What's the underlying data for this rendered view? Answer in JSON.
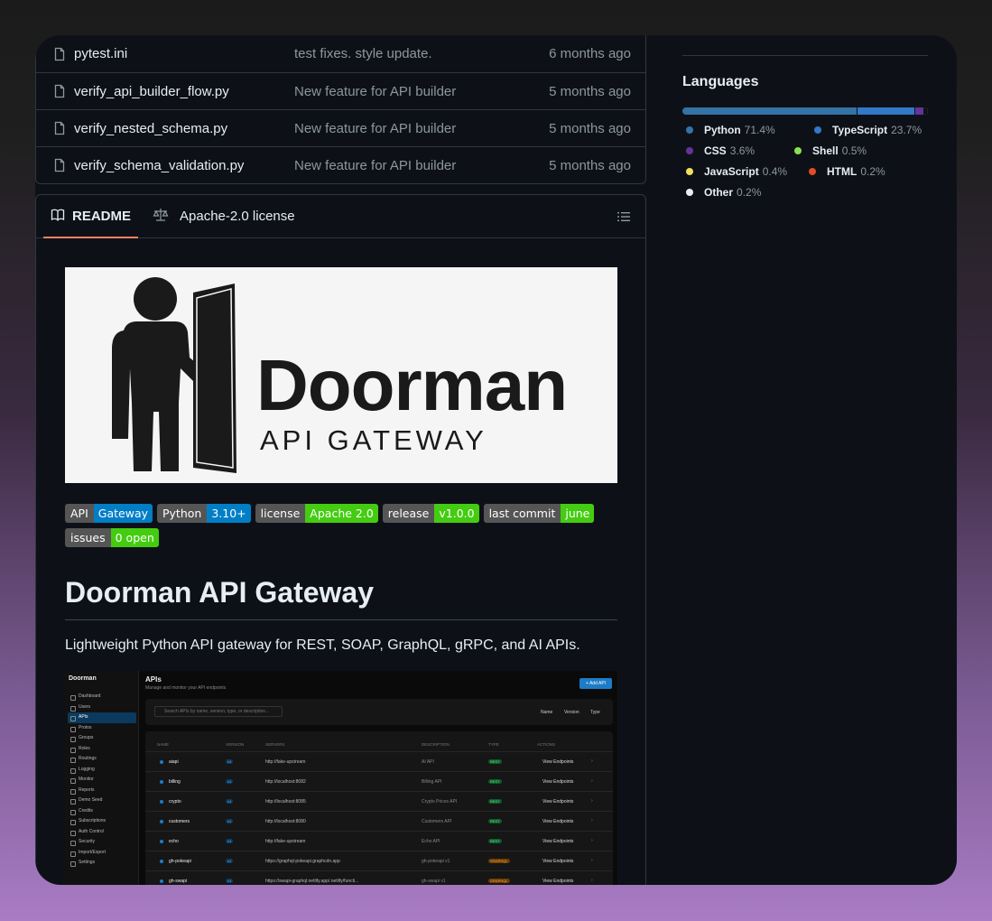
{
  "files": [
    {
      "name": "pytest.ini",
      "message": "test fixes. style update.",
      "time": "6 months ago"
    },
    {
      "name": "verify_api_builder_flow.py",
      "message": "New feature for API builder",
      "time": "5 months ago"
    },
    {
      "name": "verify_nested_schema.py",
      "message": "New feature for API builder",
      "time": "5 months ago"
    },
    {
      "name": "verify_schema_validation.py",
      "message": "New feature for API builder",
      "time": "5 months ago"
    }
  ],
  "readme": {
    "tabs": {
      "readme": "README",
      "license": "Apache-2.0 license"
    },
    "logo": {
      "title": "Doorman",
      "subtitle": "API GATEWAY"
    },
    "badges": [
      {
        "label": "API",
        "value": "Gateway",
        "color": "#007ec6"
      },
      {
        "label": "Python",
        "value": "3.10+",
        "color": "#007ec6"
      },
      {
        "label": "license",
        "value": "Apache 2.0",
        "color": "#4c1"
      },
      {
        "label": "release",
        "value": "v1.0.0",
        "color": "#4c1"
      },
      {
        "label": "last commit",
        "value": "june",
        "color": "#4c1"
      },
      {
        "label": "issues",
        "value": "0 open",
        "color": "#4c1"
      }
    ],
    "heading": "Doorman API Gateway",
    "description": "Lightweight Python API gateway for REST, SOAP, GraphQL, gRPC, and AI APIs.",
    "screenshot": {
      "brand": "Doorman",
      "nav": [
        "Dashboard",
        "Users",
        "APIs",
        "Protos",
        "Groups",
        "Roles",
        "Routings",
        "Logging",
        "Monitor",
        "Reports",
        "Demo Seed",
        "Credits",
        "Subscriptions",
        "Auth Control",
        "Security",
        "Import/Export",
        "Settings"
      ],
      "nav_active": "APIs",
      "title": "APIs",
      "subtitle": "Manage and monitor your API endpoints",
      "add_button": "+ Add API",
      "search_placeholder": "Search APIs by name, version, type, or description...",
      "filters": [
        "Name",
        "Version",
        "Type"
      ],
      "columns": [
        "NAME",
        "VERSION",
        "SERVERS",
        "DESCRIPTION",
        "TYPE",
        "ACTIONS"
      ],
      "rows": [
        {
          "name": "aiapi",
          "version": "v1",
          "server": "http://fake-upstream",
          "description": "AI API",
          "type": "REST",
          "action": "View Endpoints"
        },
        {
          "name": "billing",
          "version": "v1",
          "server": "http://localhost:8082",
          "description": "Billing API",
          "type": "REST",
          "action": "View Endpoints"
        },
        {
          "name": "crypto",
          "version": "v1",
          "server": "http://localhost:8085",
          "description": "Crypto Prices API",
          "type": "REST",
          "action": "View Endpoints"
        },
        {
          "name": "customers",
          "version": "v1",
          "server": "http://localhost:8080",
          "description": "Customers API",
          "type": "REST",
          "action": "View Endpoints"
        },
        {
          "name": "echo",
          "version": "v1",
          "server": "http://fake-upstream",
          "description": "Echo API",
          "type": "REST",
          "action": "View Endpoints"
        },
        {
          "name": "gh-pokeapi",
          "version": "v1",
          "server": "https://graphql-pokeapi.graphcdn.app",
          "description": "gh-pokeapi v1",
          "type": "GRAPHQL",
          "action": "View Endpoints"
        },
        {
          "name": "gh-swapi",
          "version": "v1",
          "server": "https://swapi-graphql.netlify.app/.netlify/functi...",
          "description": "gh-swapi v1",
          "type": "GRAPHQL",
          "action": "View Endpoints"
        }
      ]
    }
  },
  "languages": {
    "title": "Languages",
    "items": [
      {
        "name": "Python",
        "percent": "71.4%",
        "value": 71.4,
        "color": "#3572A5"
      },
      {
        "name": "TypeScript",
        "percent": "23.7%",
        "value": 23.7,
        "color": "#3178c6"
      },
      {
        "name": "CSS",
        "percent": "3.6%",
        "value": 3.6,
        "color": "#663399"
      },
      {
        "name": "Shell",
        "percent": "0.5%",
        "value": 0.5,
        "color": "#89e051"
      },
      {
        "name": "JavaScript",
        "percent": "0.4%",
        "value": 0.4,
        "color": "#f1e05a"
      },
      {
        "name": "HTML",
        "percent": "0.2%",
        "value": 0.2,
        "color": "#e34c26"
      },
      {
        "name": "Other",
        "percent": "0.2%",
        "value": 0.2,
        "color": "#ededed"
      }
    ]
  }
}
